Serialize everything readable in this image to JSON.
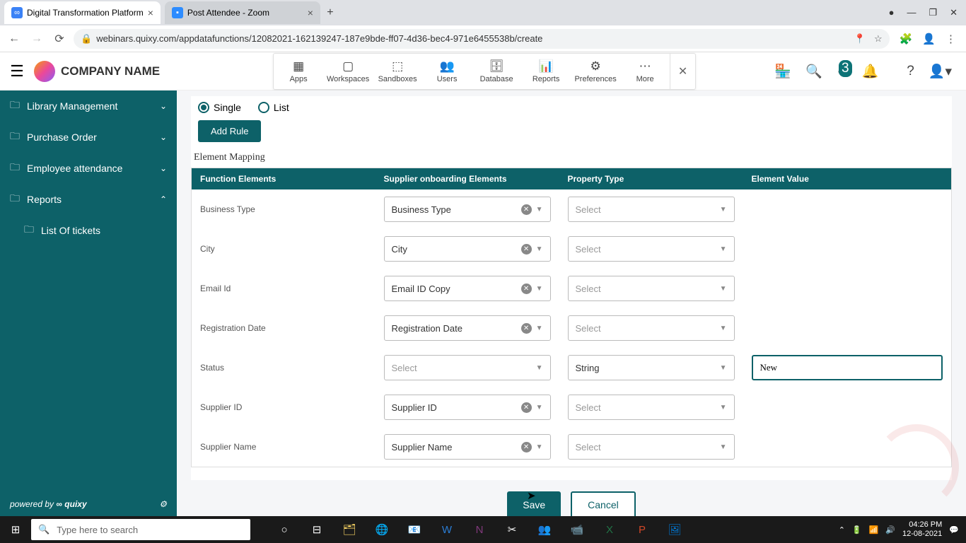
{
  "browser": {
    "tabs": [
      {
        "title": "Digital Transformation Platform",
        "icon": "quixy"
      },
      {
        "title": "Post Attendee - Zoom",
        "icon": "zoom"
      }
    ],
    "url": "webinars.quixy.com/appdatafunctions/12082021-162139247-187e9bde-ff07-4d36-bec4-971e6455538b/create"
  },
  "header": {
    "company": "COMPANY NAME",
    "nav": [
      "Apps",
      "Workspaces",
      "Sandboxes",
      "Users",
      "Database",
      "Reports",
      "Preferences",
      "More"
    ],
    "badge_count": "3"
  },
  "sidebar": {
    "items": [
      {
        "label": "Library Management",
        "expanded": false
      },
      {
        "label": "Purchase Order",
        "expanded": false
      },
      {
        "label": "Employee attendance",
        "expanded": false
      },
      {
        "label": "Reports",
        "expanded": true,
        "children": [
          {
            "label": "List Of tickets"
          }
        ]
      }
    ],
    "powered_by": "powered by",
    "brand": "quixy"
  },
  "content": {
    "mode_single": "Single",
    "mode_list": "List",
    "add_rule": "Add Rule",
    "section_title": "Element Mapping",
    "columns": [
      "Function Elements",
      "Supplier onboarding Elements",
      "Property Type",
      "Element Value"
    ],
    "rows": [
      {
        "func": "Business Type",
        "supplier": "Business Type",
        "prop": "",
        "value": ""
      },
      {
        "func": "City",
        "supplier": "City",
        "prop": "",
        "value": ""
      },
      {
        "func": "Email Id",
        "supplier": "Email ID Copy",
        "prop": "",
        "value": ""
      },
      {
        "func": "Registration Date",
        "supplier": "Registration Date",
        "prop": "",
        "value": ""
      },
      {
        "func": "Status",
        "supplier": "",
        "prop": "String",
        "value": "New"
      },
      {
        "func": "Supplier ID",
        "supplier": "Supplier ID",
        "prop": "",
        "value": ""
      },
      {
        "func": "Supplier Name",
        "supplier": "Supplier Name",
        "prop": "",
        "value": ""
      }
    ],
    "select_placeholder": "Select",
    "save": "Save",
    "cancel": "Cancel"
  },
  "taskbar": {
    "search_placeholder": "Type here to search",
    "time": "04:26 PM",
    "date": "12-08-2021"
  }
}
